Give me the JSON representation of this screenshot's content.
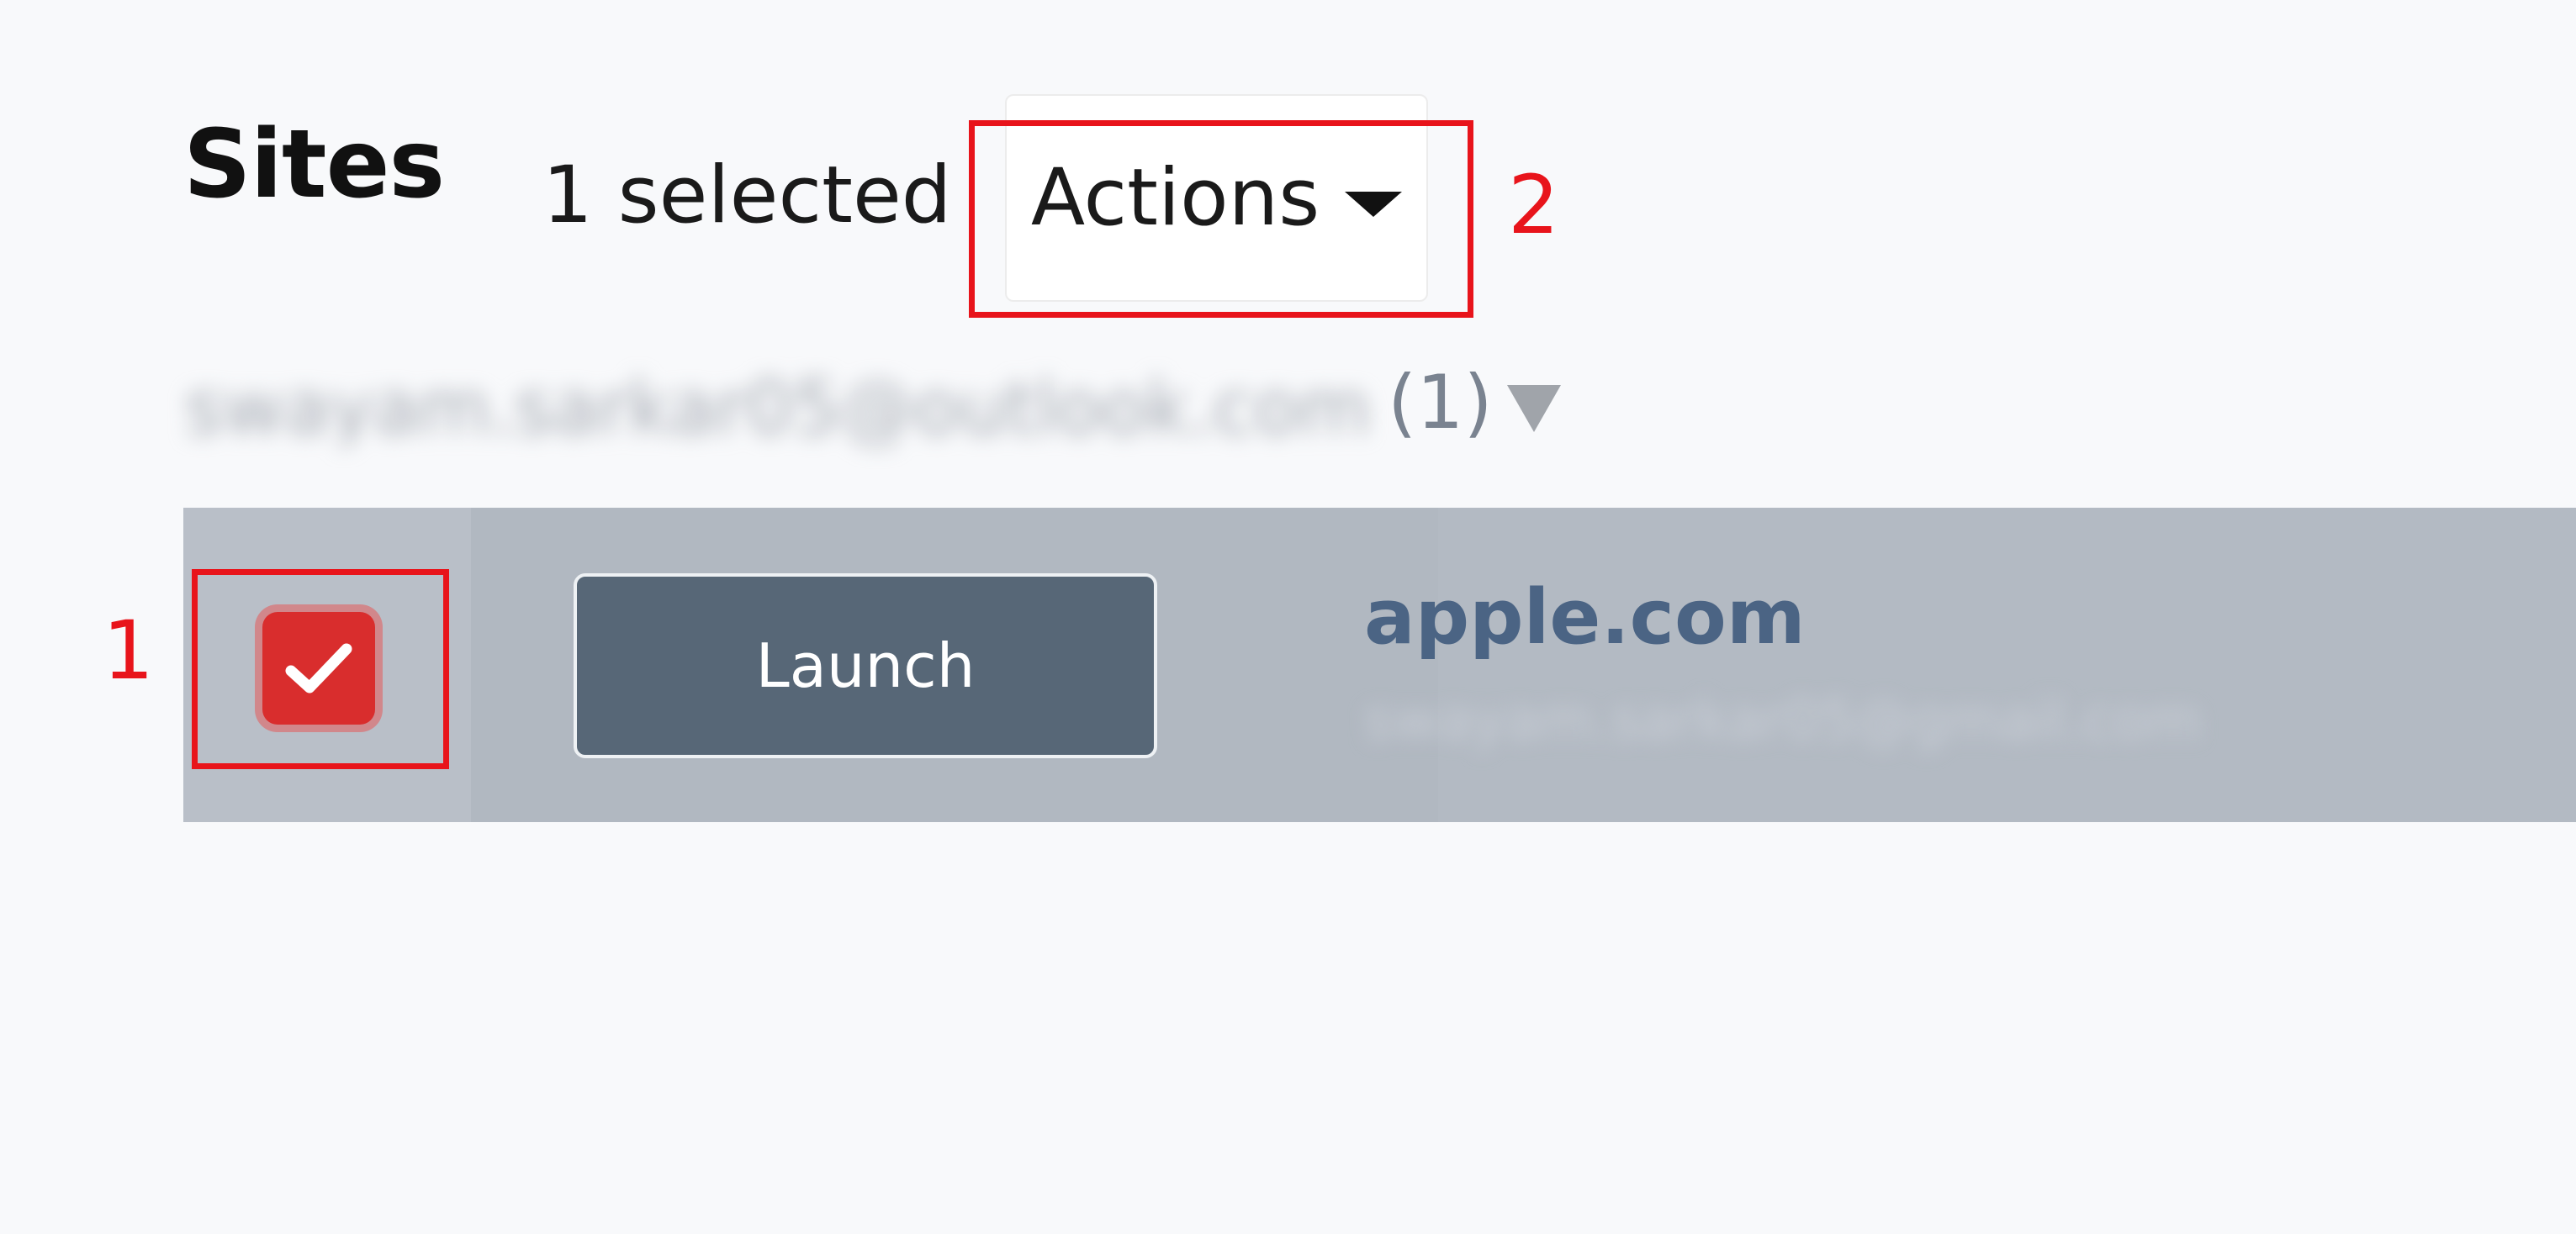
{
  "header": {
    "title": "Sites",
    "selection_count": "1 selected",
    "actions_label": "Actions"
  },
  "account": {
    "email": "swayam.sarkar05@outlook.com",
    "count": "(1)"
  },
  "sites": [
    {
      "checked": true,
      "launch_label": "Launch",
      "name": "apple.com",
      "owner": "swayam.sarkar05@gmail.com"
    }
  ],
  "annotations": [
    {
      "number": "1",
      "target": "site checkbox"
    },
    {
      "number": "2",
      "target": "actions dropdown"
    }
  ],
  "colors": {
    "annotation": "#e8141b",
    "checkbox": "#d92d2d",
    "launch_button": "#576777",
    "site_link": "#4b6484",
    "row_selected": "#b3bac3"
  }
}
